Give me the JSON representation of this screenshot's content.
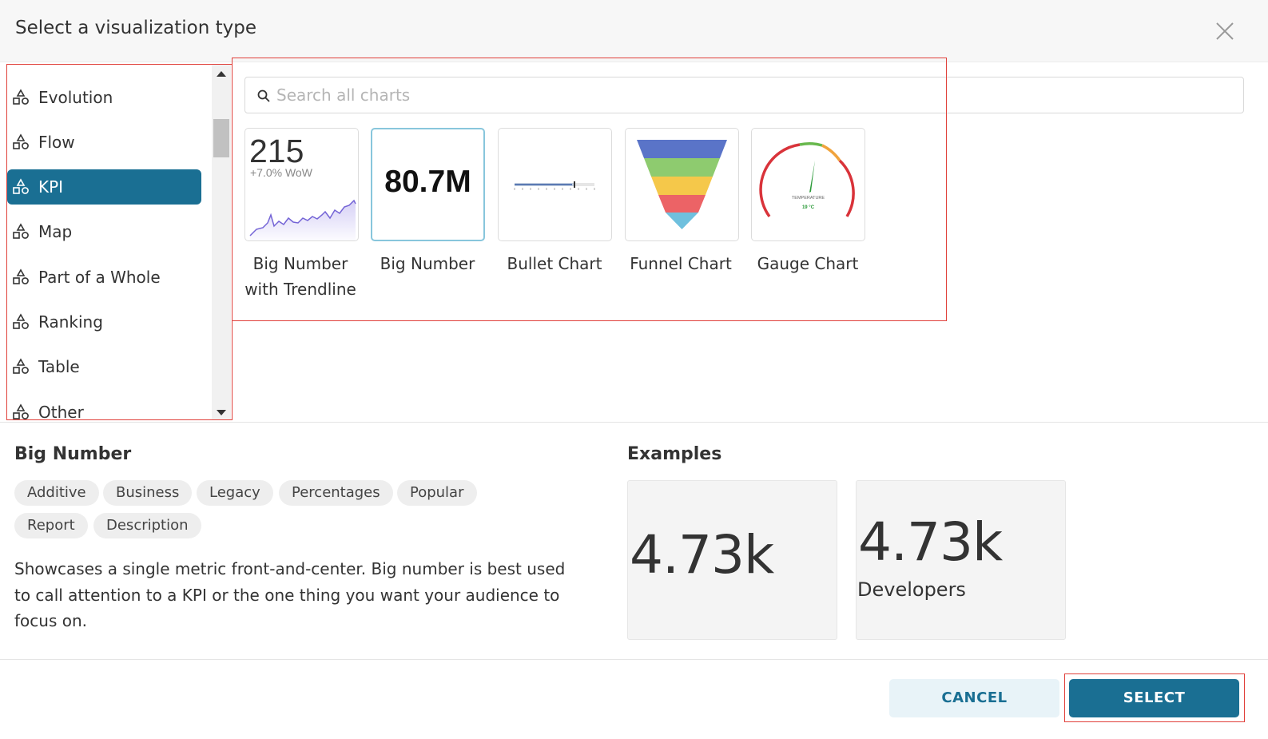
{
  "modal": {
    "title": "Select a visualization type"
  },
  "sidebar": {
    "items": [
      {
        "label": "Evolution",
        "active": false,
        "icon": "category-shapes-icon"
      },
      {
        "label": "Flow",
        "active": false,
        "icon": "category-shapes-icon"
      },
      {
        "label": "KPI",
        "active": true,
        "icon": "category-shapes-icon"
      },
      {
        "label": "Map",
        "active": false,
        "icon": "category-shapes-icon"
      },
      {
        "label": "Part of a Whole",
        "active": false,
        "icon": "category-shapes-icon"
      },
      {
        "label": "Ranking",
        "active": false,
        "icon": "category-shapes-icon"
      },
      {
        "label": "Table",
        "active": false,
        "icon": "category-shapes-icon"
      },
      {
        "label": "Other",
        "active": false,
        "icon": "category-shapes-icon"
      }
    ]
  },
  "search": {
    "placeholder": "Search all charts",
    "value": ""
  },
  "charts": [
    {
      "label": "Big Number with Trendline",
      "thumb_value": "215",
      "thumb_sub": "+7.0% WoW",
      "selected": false
    },
    {
      "label": "Big Number",
      "thumb_value": "80.7M",
      "selected": true
    },
    {
      "label": "Bullet Chart",
      "selected": false
    },
    {
      "label": "Funnel Chart",
      "selected": false
    },
    {
      "label": "Gauge Chart",
      "thumb_caption": "TEMPERATURE",
      "thumb_reading": "19 °C",
      "selected": false
    }
  ],
  "detail": {
    "title": "Big Number",
    "tags": [
      "Additive",
      "Business",
      "Legacy",
      "Percentages",
      "Popular",
      "Report",
      "Description"
    ],
    "description": "Showcases a single metric front-and-center. Big number is best used to call attention to a KPI or the one thing you want your audience to focus on.",
    "examples_title": "Examples",
    "examples": [
      {
        "value": "4.73k",
        "subheader": ""
      },
      {
        "value": "4.73k",
        "subheader": "Developers"
      }
    ]
  },
  "footer": {
    "cancel_label": "CANCEL",
    "select_label": "SELECT"
  },
  "colors": {
    "accent": "#1a6f93",
    "highlight": "#e0403a",
    "selected_border": "#88c6dc"
  }
}
